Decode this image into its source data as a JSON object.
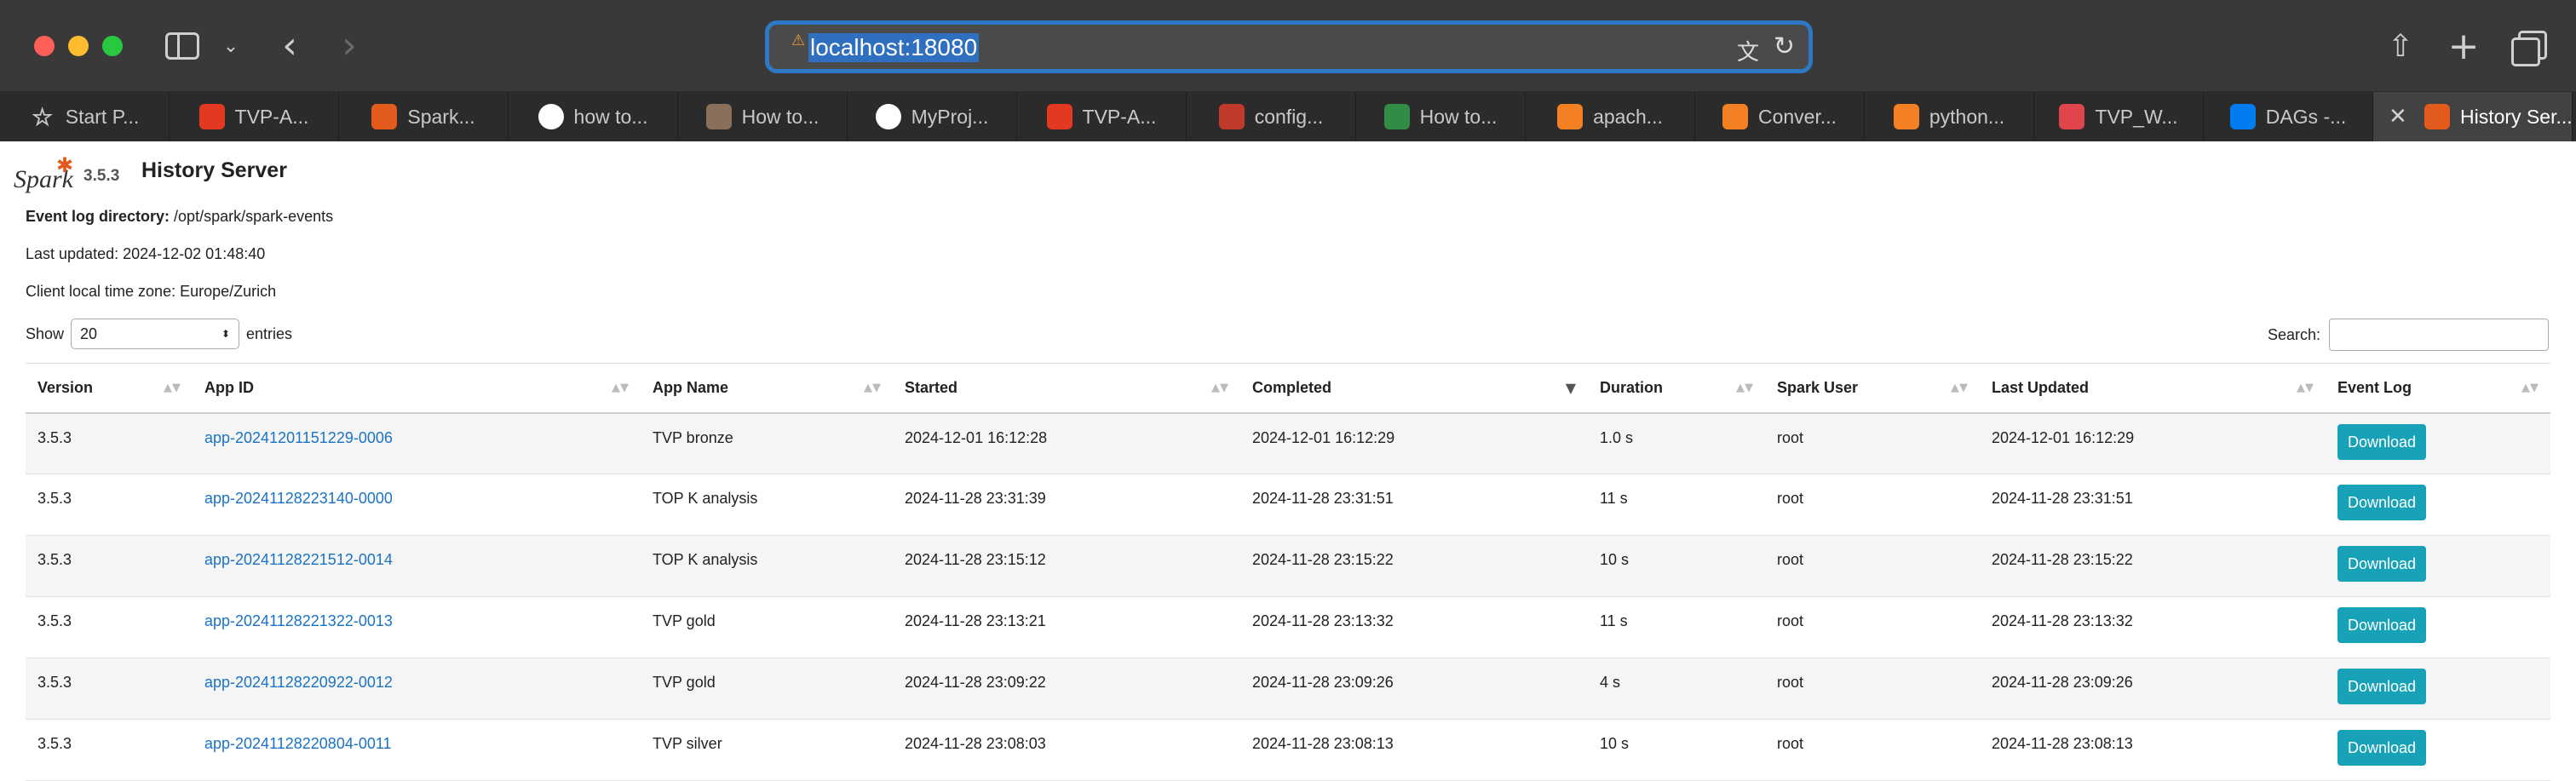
{
  "browser": {
    "url": "localhost:18080",
    "tabs": [
      {
        "label": "Start P...",
        "icon": "star-icon",
        "color": "#8a8a8a"
      },
      {
        "label": "TVP-A...",
        "icon": "airflow-icon",
        "color": "#e43921"
      },
      {
        "label": "Spark...",
        "icon": "spark-icon",
        "color": "#e25a1c"
      },
      {
        "label": "how to...",
        "icon": "google-icon",
        "color": "#4285f4"
      },
      {
        "label": "How to...",
        "icon": "avatar-icon",
        "color": "#8a6f5a"
      },
      {
        "label": "MyProj...",
        "icon": "github-icon",
        "color": "#ffffff"
      },
      {
        "label": "TVP-A...",
        "icon": "airflow-icon",
        "color": "#e43921"
      },
      {
        "label": "config...",
        "icon": "config-icon",
        "color": "#c0392b"
      },
      {
        "label": "How to...",
        "icon": "geeksforgeeks-icon",
        "color": "#2f8d46"
      },
      {
        "label": "apach...",
        "icon": "stackoverflow-icon",
        "color": "#f48024"
      },
      {
        "label": "Conver...",
        "icon": "stackoverflow-icon",
        "color": "#f48024"
      },
      {
        "label": "python...",
        "icon": "stackoverflow-icon",
        "color": "#f48024"
      },
      {
        "label": "TVP_W...",
        "icon": "notebook-icon",
        "color": "#e0454b"
      },
      {
        "label": "DAGs -...",
        "icon": "airflow-icon",
        "color": "#017cee"
      },
      {
        "label": "History Ser...",
        "icon": "spark-icon",
        "color": "#e25a1c"
      }
    ]
  },
  "header": {
    "brand": "Spark",
    "version": "3.5.3",
    "title": "History Server"
  },
  "info": {
    "event_log_label": "Event log directory:",
    "event_log_value": "/opt/spark/spark-events",
    "last_updated": "Last updated: 2024-12-02 01:48:40",
    "timezone": "Client local time zone: Europe/Zurich"
  },
  "controls": {
    "show_label": "Show",
    "entries_value": "20",
    "entries_label": "entries",
    "search_label": "Search:"
  },
  "table": {
    "columns": [
      "Version",
      "App ID",
      "App Name",
      "Started",
      "Completed",
      "Duration",
      "Spark User",
      "Last Updated",
      "Event Log"
    ],
    "download_label": "Download",
    "rows": [
      {
        "version": "3.5.3",
        "app_id": "app-20241201151229-0006",
        "app_name": "TVP bronze",
        "started": "2024-12-01 16:12:28",
        "completed": "2024-12-01 16:12:29",
        "duration": "1.0 s",
        "user": "root",
        "last_updated": "2024-12-01 16:12:29"
      },
      {
        "version": "3.5.3",
        "app_id": "app-20241128223140-0000",
        "app_name": "TOP K analysis",
        "started": "2024-11-28 23:31:39",
        "completed": "2024-11-28 23:31:51",
        "duration": "11 s",
        "user": "root",
        "last_updated": "2024-11-28 23:31:51"
      },
      {
        "version": "3.5.3",
        "app_id": "app-20241128221512-0014",
        "app_name": "TOP K analysis",
        "started": "2024-11-28 23:15:12",
        "completed": "2024-11-28 23:15:22",
        "duration": "10 s",
        "user": "root",
        "last_updated": "2024-11-28 23:15:22"
      },
      {
        "version": "3.5.3",
        "app_id": "app-20241128221322-0013",
        "app_name": "TVP gold",
        "started": "2024-11-28 23:13:21",
        "completed": "2024-11-28 23:13:32",
        "duration": "11 s",
        "user": "root",
        "last_updated": "2024-11-28 23:13:32"
      },
      {
        "version": "3.5.3",
        "app_id": "app-20241128220922-0012",
        "app_name": "TVP gold",
        "started": "2024-11-28 23:09:22",
        "completed": "2024-11-28 23:09:26",
        "duration": "4 s",
        "user": "root",
        "last_updated": "2024-11-28 23:09:26"
      },
      {
        "version": "3.5.3",
        "app_id": "app-20241128220804-0011",
        "app_name": "TVP silver",
        "started": "2024-11-28 23:08:03",
        "completed": "2024-11-28 23:08:13",
        "duration": "10 s",
        "user": "root",
        "last_updated": "2024-11-28 23:08:13"
      }
    ]
  }
}
